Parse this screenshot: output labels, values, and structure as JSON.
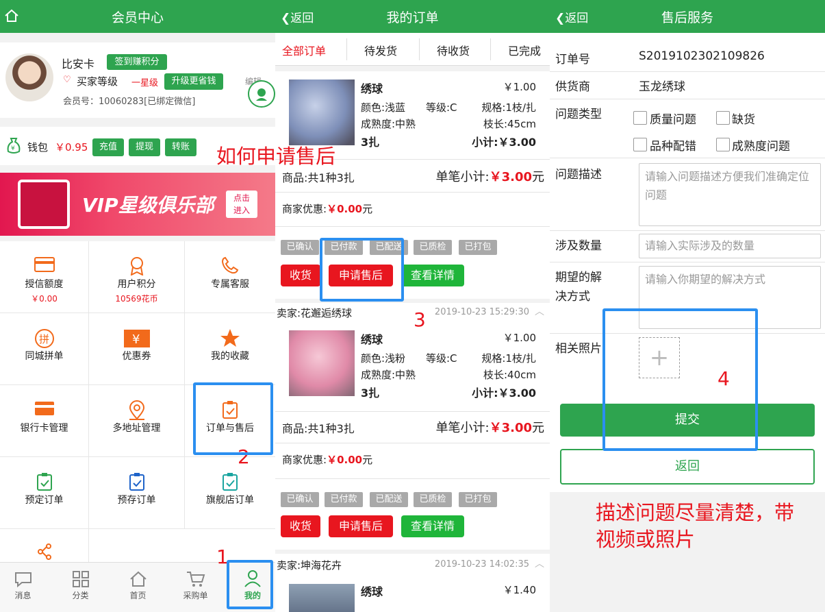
{
  "colors": {
    "brand": "#2ea44f",
    "accent_red": "#e8161f",
    "annotation_blue": "#2b8ff0"
  },
  "left": {
    "title": "会员中心",
    "user": {
      "name": "比安卡",
      "checkin": "签到赚积分",
      "level_label": "买家等级",
      "level_value": "一星级",
      "upgrade": "升级更省钱",
      "member_no": "会员号：10060283[已绑定微信]",
      "edit": "编辑"
    },
    "wallet": {
      "label": "钱包",
      "amount": "￥0.95",
      "btn_recharge": "充值",
      "btn_withdraw": "提现",
      "btn_transfer": "转账"
    },
    "banner": {
      "text": "VIP星级俱乐部",
      "cta_line1": "点击",
      "cta_line2": "进入"
    },
    "grid": [
      {
        "label": "授信额度",
        "sub": "￥0.00",
        "icon": "card-icon"
      },
      {
        "label": "用户积分",
        "sub": "10569花币",
        "icon": "medal-icon"
      },
      {
        "label": "专属客服",
        "sub": "",
        "icon": "phone-icon"
      },
      {
        "label": "同城拼单",
        "sub": "",
        "icon": "pin-group-icon"
      },
      {
        "label": "优惠券",
        "sub": "",
        "icon": "coupon-icon"
      },
      {
        "label": "我的收藏",
        "sub": "",
        "icon": "star-icon"
      },
      {
        "label": "银行卡管理",
        "sub": "",
        "icon": "bank-card-icon"
      },
      {
        "label": "多地址管理",
        "sub": "",
        "icon": "location-icon"
      },
      {
        "label": "订单与售后",
        "sub": "",
        "icon": "order-icon"
      },
      {
        "label": "预定订单",
        "sub": "",
        "icon": "clipboard-icon"
      },
      {
        "label": "预存订单",
        "sub": "",
        "icon": "clipboard-blue-icon"
      },
      {
        "label": "旗舰店订单",
        "sub": "",
        "icon": "clipboard-teal-icon"
      }
    ],
    "tabs": [
      {
        "label": "消息",
        "icon": "chat-icon"
      },
      {
        "label": "分类",
        "icon": "grid-icon"
      },
      {
        "label": "首页",
        "icon": "home-icon"
      },
      {
        "label": "采购单",
        "icon": "cart-icon"
      },
      {
        "label": "我的",
        "icon": "user-icon"
      }
    ]
  },
  "middle": {
    "back": "返回",
    "title": "我的订单",
    "tabs": [
      "全部订单",
      "待发货",
      "待收货",
      "已完成"
    ],
    "orders": [
      {
        "seller": "",
        "date": "",
        "product": "绣球",
        "price": "￥1.00",
        "color": "颜色:浅蓝",
        "grade": "等级:C",
        "spec": "规格:1枝/扎",
        "maturity": "成熟度:中熟",
        "length": "枝长:45cm",
        "qty": "3扎",
        "subtotal_label": "小计:",
        "subtotal_value": "￥3.00",
        "summary": "商品:共1种3扎",
        "single_label": "单笔小计:",
        "single_value": "￥3.00",
        "single_unit": "元",
        "discount_label": "商家优惠:",
        "discount_value": "￥0.00",
        "discount_unit": "元"
      },
      {
        "seller": "卖家:花邂逅绣球",
        "date": "2019-10-23 15:29:30",
        "product": "绣球",
        "price": "￥1.00",
        "color": "颜色:浅粉",
        "grade": "等级:C",
        "spec": "规格:1枝/扎",
        "maturity": "成熟度:中熟",
        "length": "枝长:40cm",
        "qty": "3扎",
        "subtotal_label": "小计:",
        "subtotal_value": "￥3.00",
        "summary": "商品:共1种3扎",
        "single_label": "单笔小计:",
        "single_value": "￥3.00",
        "single_unit": "元",
        "discount_label": "商家优惠:",
        "discount_value": "￥0.00",
        "discount_unit": "元"
      },
      {
        "seller": "卖家:坤海花卉",
        "date": "2019-10-23 14:02:35",
        "product": "绣球",
        "price": "￥1.40"
      }
    ],
    "status_tags": [
      "已确认",
      "已付款",
      "已配送",
      "已质检",
      "已打包"
    ],
    "btn_receive": "收货",
    "btn_aftersale": "申请售后",
    "btn_detail": "查看详情"
  },
  "right": {
    "back": "返回",
    "title": "售后服务",
    "order_no_label": "订单号",
    "order_no": "S2019102302109826",
    "supplier_label": "供货商",
    "supplier": "玉龙绣球",
    "issue_type_label": "问题类型",
    "issue_types": [
      "质量问题",
      "缺货",
      "品种配错",
      "成熟度问题"
    ],
    "desc_label": "问题描述",
    "desc_placeholder": "请输入问题描述方便我们准确定位问题",
    "qty_label": "涉及数量",
    "qty_placeholder": "请输入实际涉及的数量",
    "solution_label_1": "期望的解",
    "solution_label_2": "决方式",
    "solution_placeholder": "请输入你期望的解决方式",
    "photo_label": "相关照片",
    "submit": "提交",
    "back_btn": "返回"
  },
  "annotations": {
    "how_to": "如何申请售后",
    "step1": "1",
    "step2": "2",
    "step3": "3",
    "step4": "4",
    "tip_line1": "描述问题尽量清楚，带",
    "tip_line2": "视频或照片"
  }
}
